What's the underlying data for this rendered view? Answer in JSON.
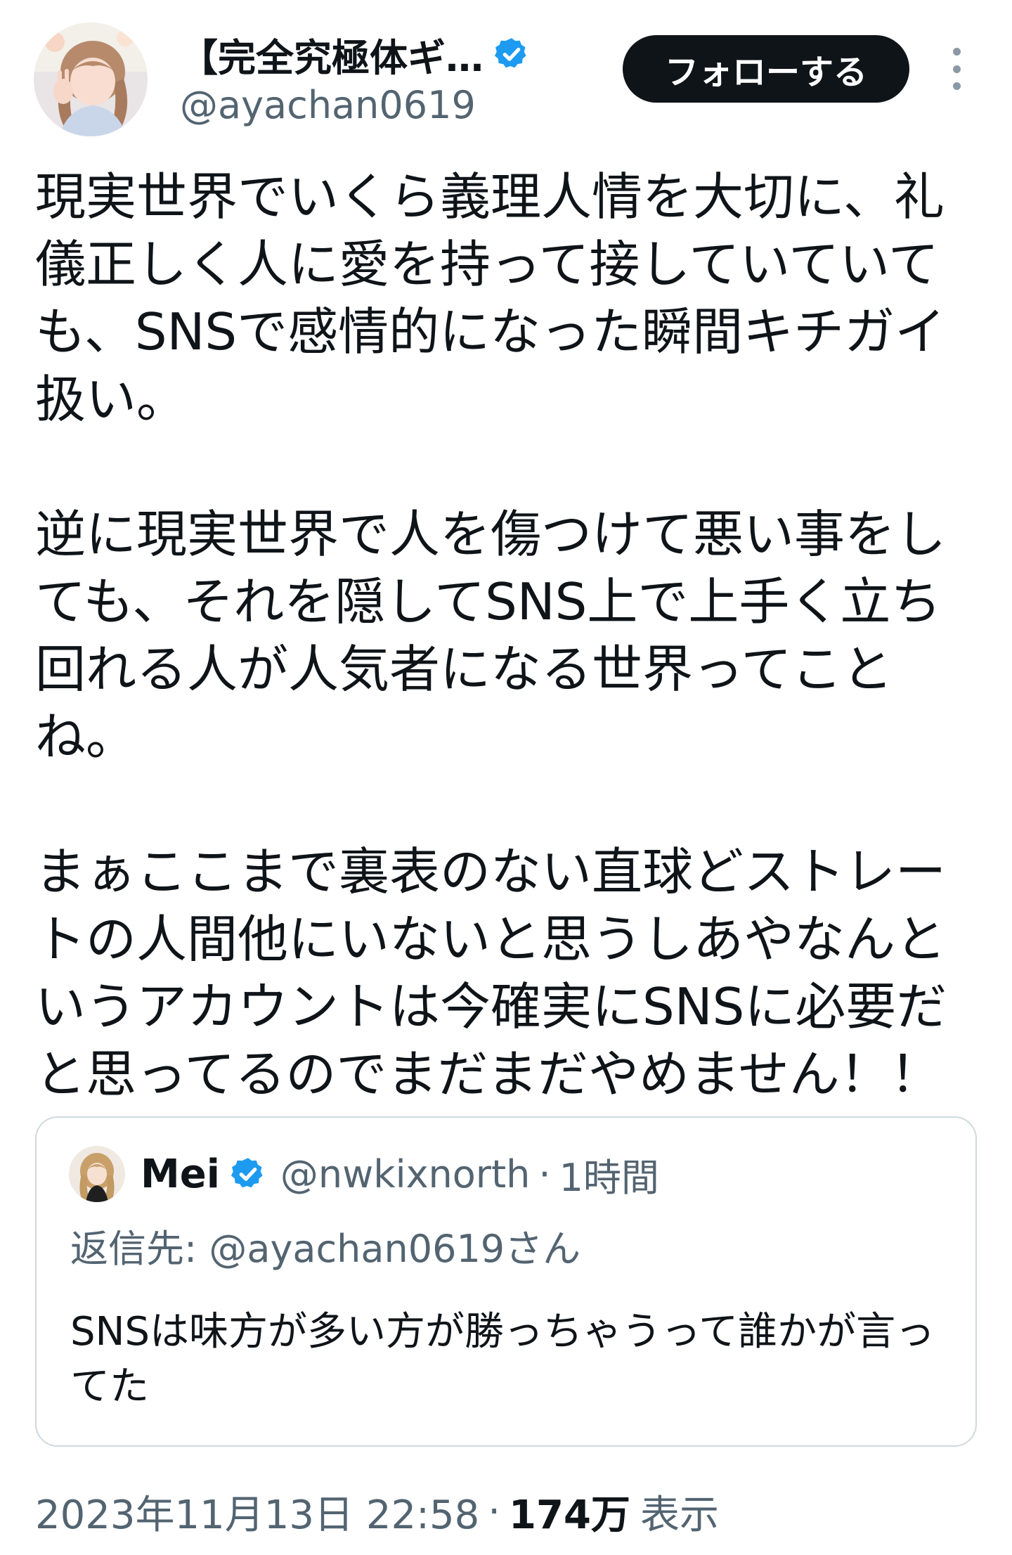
{
  "author": {
    "display_name": "【完全究極体ギ…",
    "handle": "@ayachan0619",
    "avatar_icon": "user-avatar-photo",
    "verified_icon": "verified-badge-icon"
  },
  "actions": {
    "follow_label": "フォローする",
    "more_icon": "more-vertical-icon"
  },
  "tweet": {
    "paragraphs": [
      "現実世界でいくら義理人情を大切に、礼儀正しく人に愛を持って接していていても、SNSで感情的になった瞬間キチガイ扱い。",
      "逆に現実世界で人を傷つけて悪い事をしても、それを隠してSNS上で上手く立ち回れる人が人気者になる世界ってことね。",
      "まぁここまで裏表のない直球どストレートの人間他にいないと思うしあやなんというアカウントは今確実にSNSに必要だと思ってるのでまだまだやめません！！"
    ]
  },
  "quote": {
    "name": "Mei",
    "handle": "@nwkixnorth",
    "separator": "·",
    "time": "1時間",
    "reply_to": "返信先: @ayachan0619さん",
    "text": "SNSは味方が多い方が勝っちゃうって誰かが言ってた"
  },
  "meta": {
    "timestamp": "2023年11月13日 22:58",
    "separator": "·",
    "views_count": "174万",
    "views_label": "表示"
  },
  "colors": {
    "text_primary": "#0f1419",
    "text_secondary": "#536471",
    "verified_blue": "#1d9bf0",
    "follow_bg": "#0f1419",
    "border": "#cfd9de"
  }
}
